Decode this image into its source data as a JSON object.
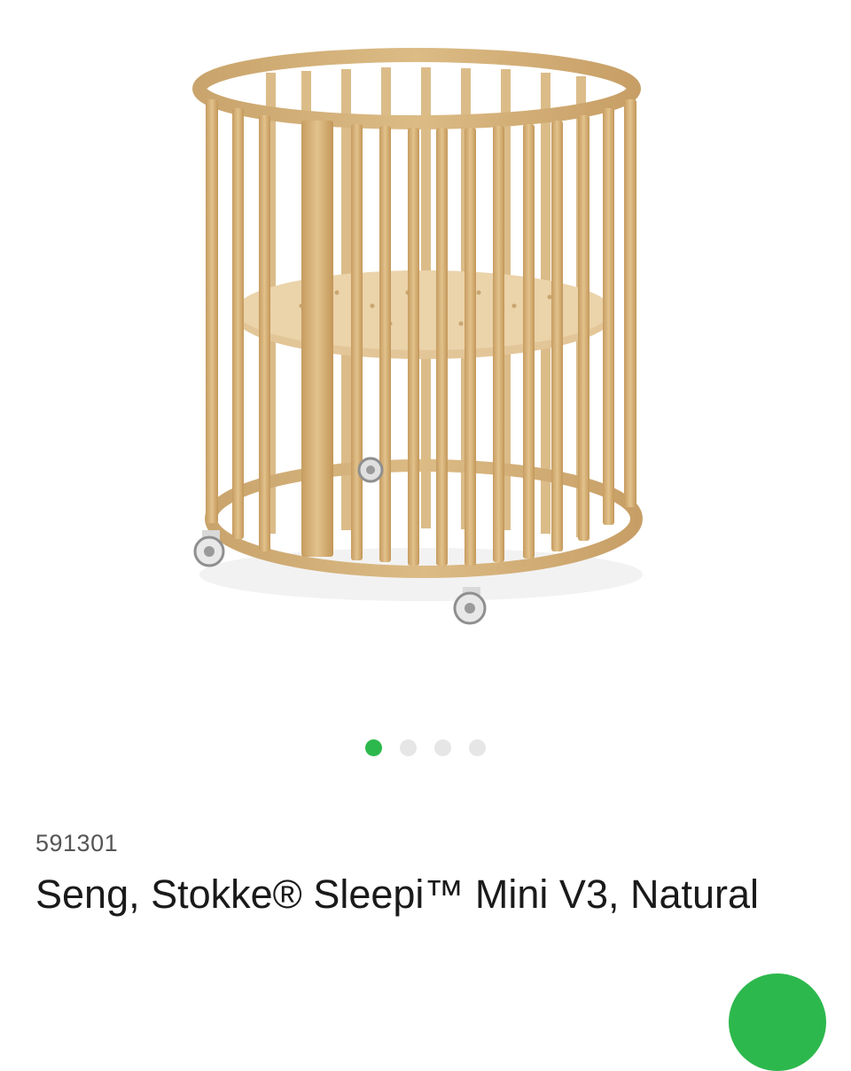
{
  "product": {
    "article_number": "591301",
    "title": "Seng, Stokke® Sleepi™ Mini V3, Natural",
    "image_icon": "crib-illustration"
  },
  "carousel": {
    "total": 4,
    "active_index": 0,
    "active_color": "#2db84d",
    "inactive_color": "#e6e6e6"
  },
  "fab": {
    "color": "#2db84d",
    "icon": "green-action-button"
  }
}
